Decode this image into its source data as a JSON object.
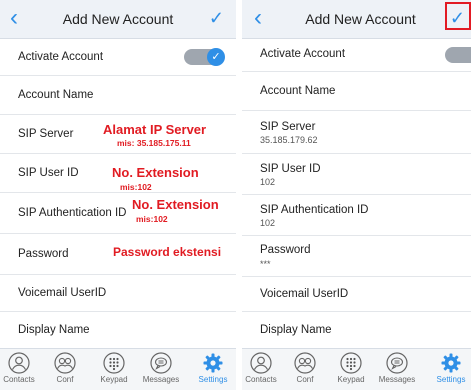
{
  "left_screen": {
    "header": {
      "back": "‹",
      "title": "Add New Account",
      "confirm": "✓"
    },
    "fields": [
      {
        "label": "Activate Account"
      },
      {
        "label": "Account Name"
      },
      {
        "label": "SIP Server"
      },
      {
        "label": "SIP User ID"
      },
      {
        "label": "SIP Authentication ID"
      },
      {
        "label": "Password"
      },
      {
        "label": "Voicemail UserID"
      },
      {
        "label": "Display Name"
      }
    ],
    "toggle_on": true,
    "annotations": {
      "server_title": "Alamat IP Server",
      "server_example": "mis: 35.185.175.11",
      "userid_title": "No. Extension",
      "userid_example": "mis:102",
      "auth_title": "No. Extension",
      "auth_example": "mis:102",
      "password_note": "Password ekstensi"
    }
  },
  "right_screen": {
    "header": {
      "back": "‹",
      "title": "Add New Account",
      "confirm": "✓"
    },
    "fields": [
      {
        "label": "Activate Account"
      },
      {
        "label": "Account Name"
      },
      {
        "label": "SIP Server",
        "value": "35.185.179.62"
      },
      {
        "label": "SIP User ID",
        "value": "102"
      },
      {
        "label": "SIP Authentication ID",
        "value": "102"
      },
      {
        "label": "Password",
        "value": "***"
      },
      {
        "label": "Voicemail UserID"
      },
      {
        "label": "Display Name"
      }
    ],
    "toggle_on": true
  },
  "tabs": [
    {
      "label": "Contacts",
      "icon": "contacts-icon"
    },
    {
      "label": "Conf",
      "icon": "conference-icon"
    },
    {
      "label": "Keypad",
      "icon": "keypad-icon"
    },
    {
      "label": "Messages",
      "icon": "messages-icon"
    },
    {
      "label": "Settings",
      "icon": "gear-icon",
      "active": true
    }
  ],
  "colors": {
    "accent": "#2f8fe6",
    "annotation": "#e11b22",
    "highlight_box": "#e21b24"
  }
}
